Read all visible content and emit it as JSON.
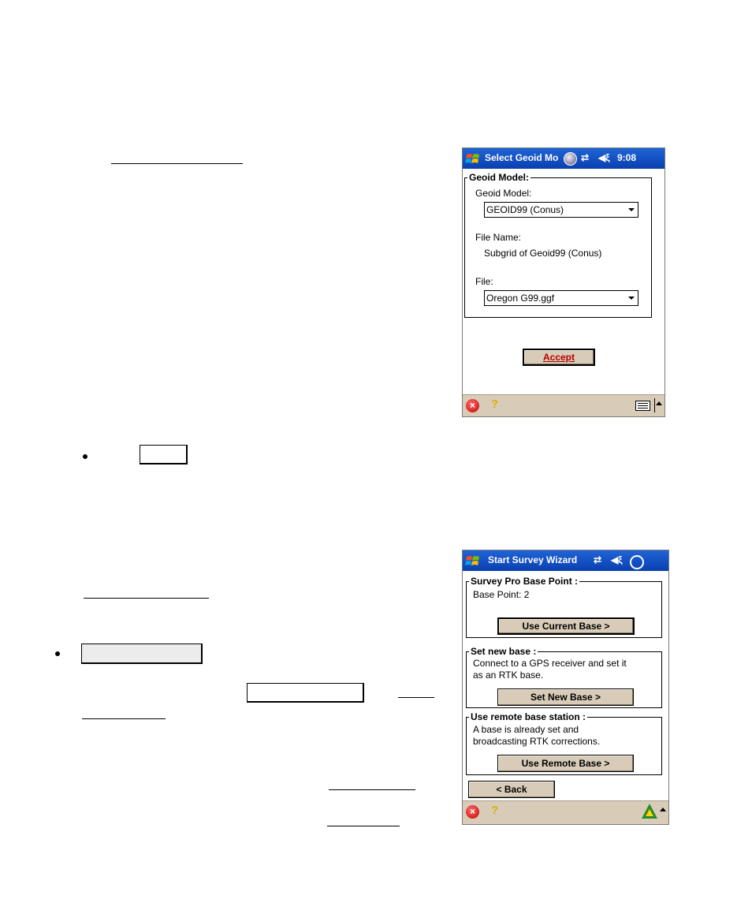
{
  "window1": {
    "title": "Select Geoid Mo",
    "time": "9:08",
    "tray_icons": [
      "globe-icon",
      "connectivity-icon",
      "speaker-icon"
    ],
    "group_title": "Geoid Model:",
    "geoid_label": "Geoid Model:",
    "geoid_value": "GEOID99 (Conus)",
    "filename_label": "File Name:",
    "filename_value": "Subgrid of Geoid99 (Conus)",
    "file_label": "File:",
    "file_value": "Oregon G99.ggf",
    "accept_label": "Accept"
  },
  "window2": {
    "title": "Start Survey Wizard",
    "tray_icons": [
      "connectivity-icon",
      "speaker-icon",
      "clock-icon"
    ],
    "group1_title": "Survey Pro Base Point :",
    "base_point": "Base Point: 2",
    "use_current_label": "Use Current Base >",
    "group2_title": "Set new base :",
    "group2_desc_line1": "Connect to a GPS receiver and set it",
    "group2_desc_line2": "as an RTK base.",
    "set_new_label": "Set New Base >",
    "group3_title": "Use remote base station :",
    "group3_desc_line1": "A base is already set and",
    "group3_desc_line2": "broadcasting RTK corrections.",
    "use_remote_label": "Use Remote Base >",
    "back_label": "< Back"
  },
  "colors": {
    "titlebar": "#0a3fb0",
    "command_bar": "#d8ccb8",
    "accept_text": "#b50000"
  }
}
